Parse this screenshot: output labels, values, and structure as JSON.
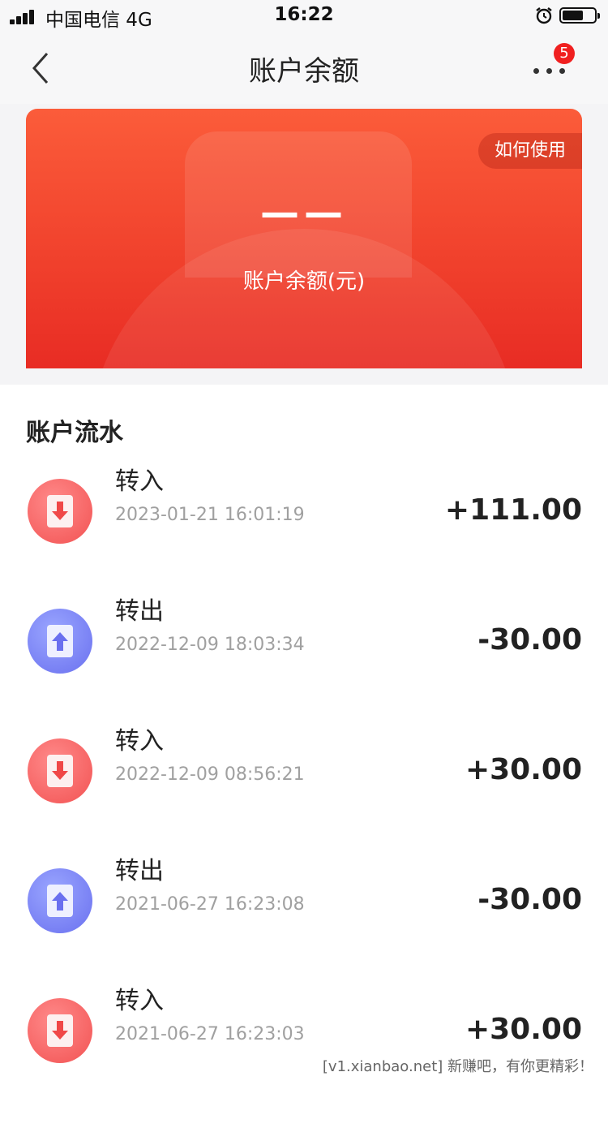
{
  "status_bar": {
    "carrier": "中国电信  4G",
    "time": "16:22",
    "battery_level": 0.65
  },
  "nav": {
    "title": "账户余额",
    "badge_count": "5"
  },
  "balance_card": {
    "how_to_use": "如何使用",
    "balance_value": "——",
    "balance_label": "账户余额(元)"
  },
  "section_title": "账户流水",
  "transactions": [
    {
      "type": "转入",
      "time": "2023-01-21 16:01:19",
      "amount": "+111.00",
      "direction": "in"
    },
    {
      "type": "转出",
      "time": "2022-12-09 18:03:34",
      "amount": "-30.00",
      "direction": "out"
    },
    {
      "type": "转入",
      "time": "2022-12-09 08:56:21",
      "amount": "+30.00",
      "direction": "in"
    },
    {
      "type": "转出",
      "time": "2021-06-27 16:23:08",
      "amount": "-30.00",
      "direction": "out"
    },
    {
      "type": "转入",
      "time": "2021-06-27 16:23:03",
      "amount": "+30.00",
      "direction": "in"
    }
  ],
  "watermark": "[v1.xianbao.net] 新赚吧，有你更精彩！",
  "colors": {
    "accent_red": "#f0402c",
    "in_icon": "#f25252",
    "out_icon": "#6a70ef"
  }
}
